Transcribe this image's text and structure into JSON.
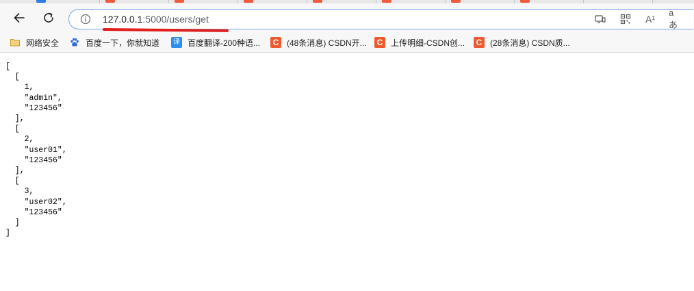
{
  "browser": {
    "address_bar": {
      "url_host": "127.0.0.1",
      "url_rest": ":5000/users/get"
    },
    "icons": {
      "back": "arrow-left-icon",
      "reload": "reload-icon",
      "site_info": "info-icon",
      "immersive_reader": "immersive-reader-icon",
      "qr_code": "qr-code-icon",
      "read_aloud": "read-aloud-icon",
      "translate": "translate-icon"
    },
    "read_aloud_glyph": "A¹",
    "translate_glyph": "aあ"
  },
  "bookmarks": [
    {
      "label": "网络安全",
      "icon": "folder-icon"
    },
    {
      "label": "百度一下，你就知道",
      "icon": "baidu-paw-icon"
    },
    {
      "label": "百度翻译-200种语...",
      "icon": "translate-icon",
      "glyph": "译"
    },
    {
      "label": "(48条消息) CSDN开...",
      "icon": "csdn-icon",
      "glyph": "C"
    },
    {
      "label": "上传明细-CSDN创...",
      "icon": "csdn-icon",
      "glyph": "C"
    },
    {
      "label": "(28条消息) CSDN质...",
      "icon": "csdn-icon",
      "glyph": "C"
    }
  ],
  "page": {
    "json_text": "[\n  [\n    1,\n    \"admin\",\n    \"123456\"\n  ],\n  [\n    2,\n    \"user01\",\n    \"123456\"\n  ],\n  [\n    3,\n    \"user02\",\n    \"123456\"\n  ]\n]"
  },
  "colors": {
    "address_border": "#7aa4e8",
    "annotation_underline": "#e0201c",
    "csdn_red": "#f0592f"
  }
}
